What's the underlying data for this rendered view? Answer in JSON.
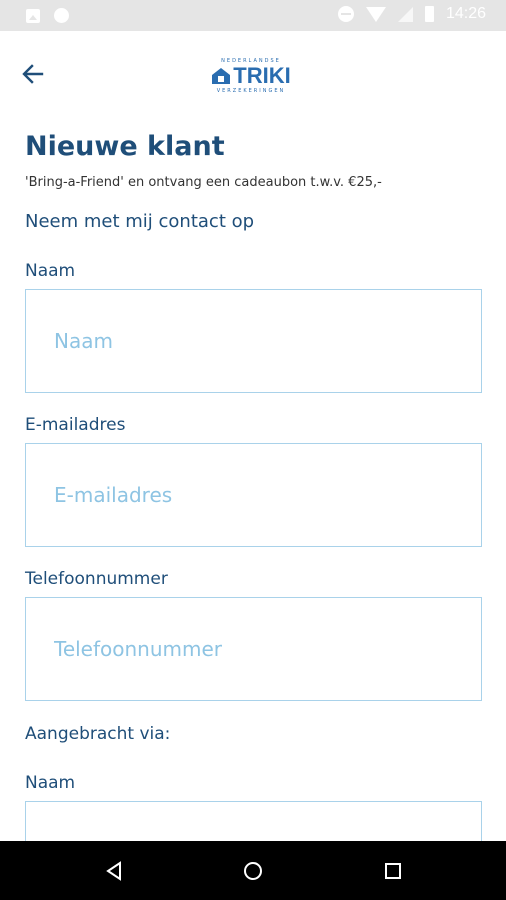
{
  "status_bar": {
    "time": "14:26",
    "icons": [
      "image-notification-icon",
      "circle-notification-icon",
      "do-not-disturb-icon",
      "wifi-icon",
      "signal-icon",
      "battery-icon"
    ]
  },
  "app_bar": {
    "back_icon": "arrow-left-icon",
    "logo": {
      "top_text": "NEDERLANDSE",
      "word": "TRIKI",
      "bottom_text": "VERZEKERINGEN"
    }
  },
  "main": {
    "title": "Nieuwe klant",
    "subtitle": "'Bring-a-Friend' en ontvang een cadeaubon t.w.v. €25,-",
    "contact_link": "Neem met mij contact op",
    "fields": [
      {
        "label": "Naam",
        "value": "",
        "placeholder": "Naam"
      },
      {
        "label": "E-mailadres",
        "value": "",
        "placeholder": "E-mailadres"
      },
      {
        "label": "Telefoonnummer",
        "value": "",
        "placeholder": "Telefoonnummer"
      }
    ],
    "section_via": "Aangebracht via:",
    "via_fields": [
      {
        "label": "Naam",
        "value": "",
        "placeholder": ""
      }
    ]
  },
  "nav_bar": {
    "icons": [
      "back-triangle-icon",
      "home-circle-icon",
      "recents-square-icon"
    ]
  },
  "colors": {
    "primary": "#1f4e79",
    "logo_blue": "#2a6db0",
    "input_border": "#a9d2ea",
    "placeholder": "#8ec4e3",
    "status_bar": "#e5e5e5"
  }
}
